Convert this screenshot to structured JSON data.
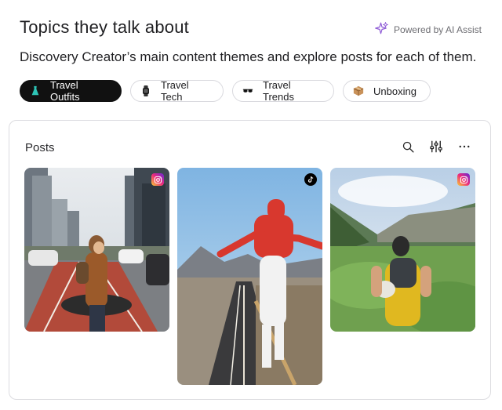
{
  "header": {
    "title": "Topics they talk about",
    "powered_by": "Powered by AI Assist",
    "subtitle": "Discovery Creator’s main content themes and explore posts for each of them."
  },
  "topics": [
    {
      "label": "Travel Outfits",
      "icon": "dress-icon",
      "active": true
    },
    {
      "label": "Travel Tech",
      "icon": "smartwatch-icon",
      "active": false
    },
    {
      "label": "Travel Trends",
      "icon": "sunglasses-icon",
      "active": false
    },
    {
      "label": "Unboxing",
      "icon": "package-icon",
      "active": false
    }
  ],
  "posts_panel": {
    "title": "Posts",
    "actions": [
      "search-icon",
      "filter-sliders-icon",
      "more-icon"
    ],
    "items": [
      {
        "platform": "instagram",
        "scene": "woman in city street crosswalk"
      },
      {
        "platform": "tiktok",
        "scene": "person in red hat on road with arms out"
      },
      {
        "platform": "instagram",
        "scene": "hiker with backpack in green valley"
      }
    ]
  },
  "colors": {
    "accent_active_chip": "#111111",
    "instagram": "#d6249f",
    "tiktok": "#000000",
    "sparkle": "#8e5bd6"
  }
}
